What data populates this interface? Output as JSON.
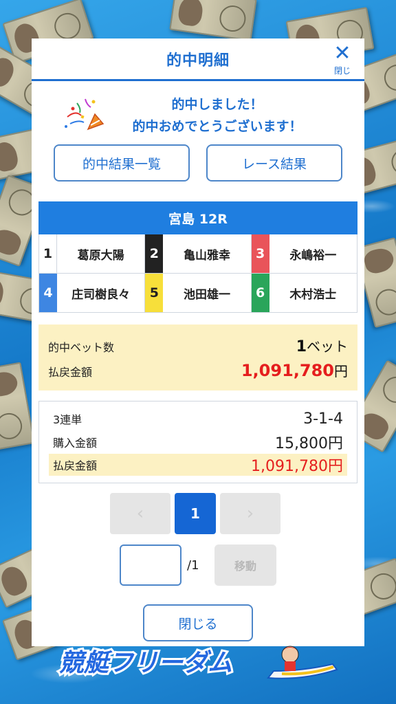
{
  "modal": {
    "title": "的中明細",
    "close_label": "閉じ"
  },
  "congrats": {
    "line1": "的中しました！",
    "line2": "的中おめでとうございます！"
  },
  "buttons": {
    "hit_list": "的中結果一覧",
    "race_result": "レース結果",
    "close": "閉じる"
  },
  "race": {
    "title": "宮島 12R",
    "racers": [
      {
        "num": "1",
        "name": "葛原大陽",
        "bg": "#ffffff",
        "fg": "#222222"
      },
      {
        "num": "2",
        "name": "亀山雅幸",
        "bg": "#222222",
        "fg": "#ffffff"
      },
      {
        "num": "3",
        "name": "永嶋裕一",
        "bg": "#e9545a",
        "fg": "#ffffff"
      },
      {
        "num": "4",
        "name": "庄司樹良々",
        "bg": "#3e86e2",
        "fg": "#ffffff"
      },
      {
        "num": "5",
        "name": "池田雄一",
        "bg": "#f7df3a",
        "fg": "#222222"
      },
      {
        "num": "6",
        "name": "木村浩士",
        "bg": "#2aa55a",
        "fg": "#ffffff"
      }
    ]
  },
  "summary": {
    "bet_count_label": "的中ベット数",
    "bet_count": "1",
    "bet_unit": "ベット",
    "payout_label": "払戻金額",
    "payout": "1,091,780",
    "payout_unit": "円"
  },
  "detail": {
    "type_label": "3連単",
    "combination": "3-1-4",
    "purchase_label": "購入金額",
    "purchase": "15,800円",
    "payout_label": "払戻金額",
    "payout": "1,091,780円"
  },
  "pager": {
    "prev": "‹",
    "current": "1",
    "next": "›",
    "total": "/1",
    "move": "移動"
  },
  "logo_text": "競艇フリーダム",
  "colors": {
    "accent": "#1f6fd0",
    "red": "#e51e1e",
    "highlight": "#fcf1c3"
  }
}
